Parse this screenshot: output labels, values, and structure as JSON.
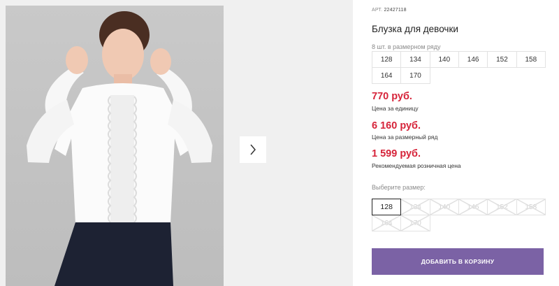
{
  "product": {
    "art_label": "АРТ.",
    "art_value": "22427118",
    "title": "Блузка для девочки",
    "pack_label": "8 шт. в размерном ряду",
    "pack_sizes": [
      "128",
      "134",
      "140",
      "146",
      "152",
      "158",
      "164",
      "170"
    ]
  },
  "prices": {
    "unit_price": "770 руб.",
    "unit_note": "Цена за единицу",
    "pack_price": "6 160 руб.",
    "pack_note": "Цена за размерный ряд",
    "retail_price": "1 599 руб.",
    "retail_note": "Рекомендуемая розничная цена"
  },
  "size_picker": {
    "label": "Выберите размер:",
    "options": [
      {
        "label": "128",
        "state": "selected"
      },
      {
        "label": "134",
        "state": "disabled"
      },
      {
        "label": "140",
        "state": "disabled"
      },
      {
        "label": "146",
        "state": "disabled"
      },
      {
        "label": "152",
        "state": "disabled"
      },
      {
        "label": "158",
        "state": "disabled"
      },
      {
        "label": "164",
        "state": "disabled"
      },
      {
        "label": "170",
        "state": "disabled"
      }
    ]
  },
  "cart": {
    "add_label": "ДОБАВИТЬ В КОРЗИНУ"
  },
  "gallery": {
    "next_icon": "chevron-right-icon"
  },
  "colors": {
    "price": "#d6243a",
    "button": "#7b62a5",
    "border": "#e2e2e2"
  }
}
